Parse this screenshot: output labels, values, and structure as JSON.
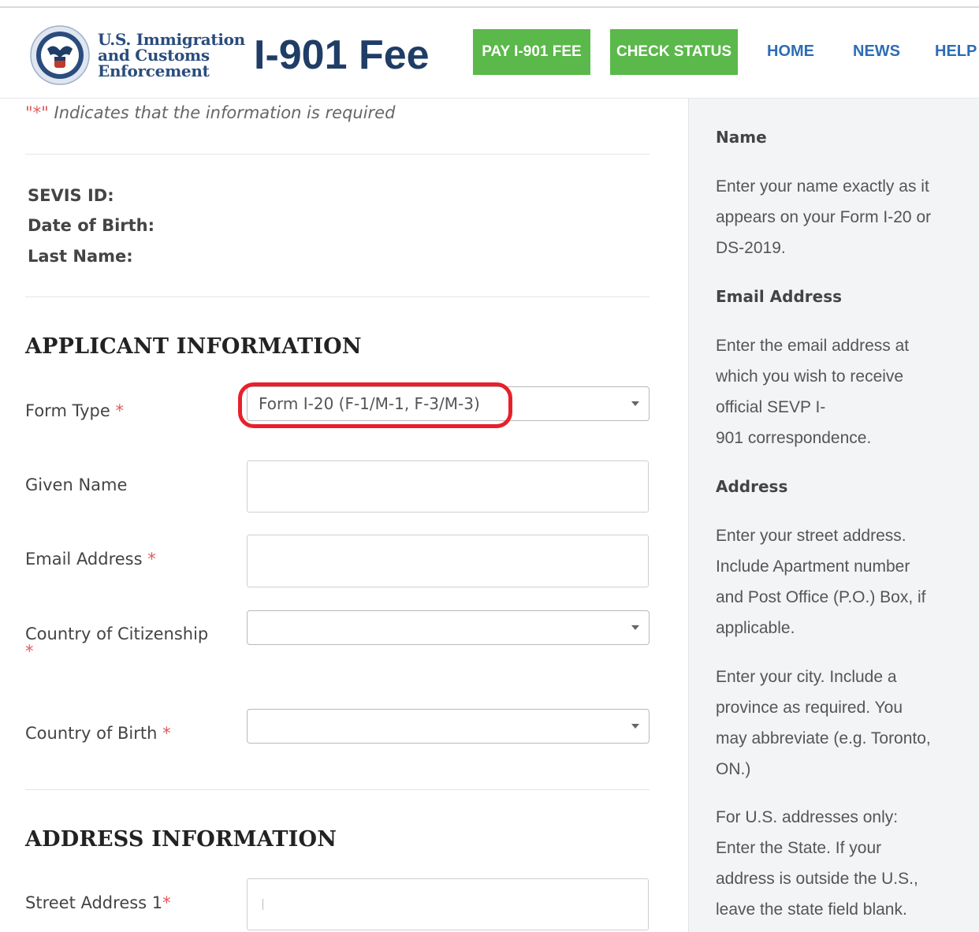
{
  "header": {
    "agency_line1": "U.S. Immigration",
    "agency_line2": "and Customs",
    "agency_line3": "Enforcement",
    "brand_title": "I-901 Fee",
    "pay_button": "PAY I-901 FEE",
    "status_button": "CHECK STATUS",
    "nav": {
      "home": "HOME",
      "news": "NEWS",
      "help": "HELP"
    }
  },
  "form": {
    "required_note_stars": "\"*\"",
    "required_note_text": " Indicates that the information is required",
    "info_labels": {
      "sevis": "SEVIS ID:",
      "dob": "Date of Birth:",
      "last_name": "Last Name:"
    },
    "applicant_section": "APPLICANT INFORMATION",
    "fields": {
      "form_type_label": "Form Type",
      "form_type_value": "Form I-20 (F-1/M-1, F-3/M-3)",
      "given_name_label": "Given Name",
      "given_name_value": "",
      "email_label": "Email Address",
      "email_value": "",
      "citizenship_label": "Country of Citizenship",
      "citizenship_value": "",
      "birth_country_label": "Country of Birth",
      "birth_country_value": "",
      "street1_label": "Street Address 1",
      "street1_value": ""
    },
    "required_mark": "*",
    "address_section": "ADDRESS INFORMATION"
  },
  "sidebar": {
    "name_heading": "Name",
    "name_lines": [
      "Enter your name exactly as it",
      "appears on your Form I-20 or",
      "DS-2019."
    ],
    "email_heading": "Email Address",
    "email_lines": [
      "Enter the email address at",
      "which you wish to receive",
      "official SEVP I-",
      "901 correspondence."
    ],
    "address_heading": "Address",
    "address_lines": [
      "Enter your street address.",
      "Include Apartment number",
      "and Post Office (P.O.) Box, if",
      "applicable."
    ],
    "city_lines": [
      "Enter your city. Include a",
      "province as required. You",
      "may abbreviate (e.g. Toronto,",
      "ON.)"
    ],
    "state_lines": [
      "For U.S. addresses only:",
      "Enter the State. If your",
      "address is outside the U.S.,",
      "leave the state field blank."
    ]
  },
  "colors": {
    "green": "#5bb84a",
    "navy": "#1f3d66",
    "link_blue": "#2d6db5",
    "required_red": "#e05a5a",
    "highlight_red": "#e8202b"
  }
}
